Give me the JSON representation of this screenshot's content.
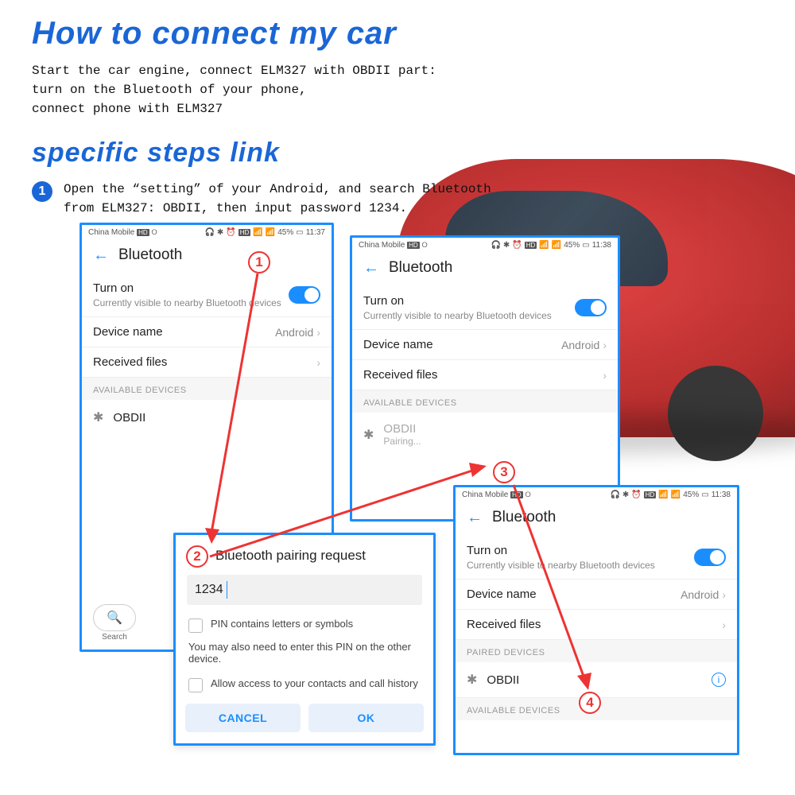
{
  "title": "How to connect my car",
  "intro_line1": "Start the car engine, connect ELM327 with OBDII part:",
  "intro_line2": "turn on the Bluetooth of your phone,",
  "intro_line3": "connect phone with ELM327",
  "subtitle": "specific steps link",
  "step1_bullet": "1",
  "step1_text_a": "Open the “setting” of your Android, and search Bluetooth",
  "step1_text_b": "from ELM327: OBDII, then input password 1234.",
  "callouts": {
    "c1": "1",
    "c2": "2",
    "c3": "3",
    "c4": "4"
  },
  "status": {
    "carrier": "China Mobile",
    "battery": "45%",
    "time1": "11:37",
    "time2": "11:38"
  },
  "bt": {
    "header": "Bluetooth",
    "turn_on": "Turn on",
    "turn_on_sub": "Currently visible to nearby Bluetooth devices",
    "device_name_lbl": "Device name",
    "device_name_val": "Android",
    "received_files": "Received files",
    "available_hdr": "AVAILABLE DEVICES",
    "paired_hdr": "PAIRED DEVICES",
    "obdii": "OBDII",
    "pairing": "Pairing...",
    "search": "Search"
  },
  "dialog": {
    "title": "Bluetooth pairing request",
    "pin": "1234",
    "chk1": "PIN contains letters or symbols",
    "note": "You may also need to enter this PIN on the other device.",
    "chk2": "Allow access to your contacts and call history",
    "cancel": "CANCEL",
    "ok": "OK"
  },
  "icons": {
    "hd": "HD",
    "swirl": "୦"
  }
}
